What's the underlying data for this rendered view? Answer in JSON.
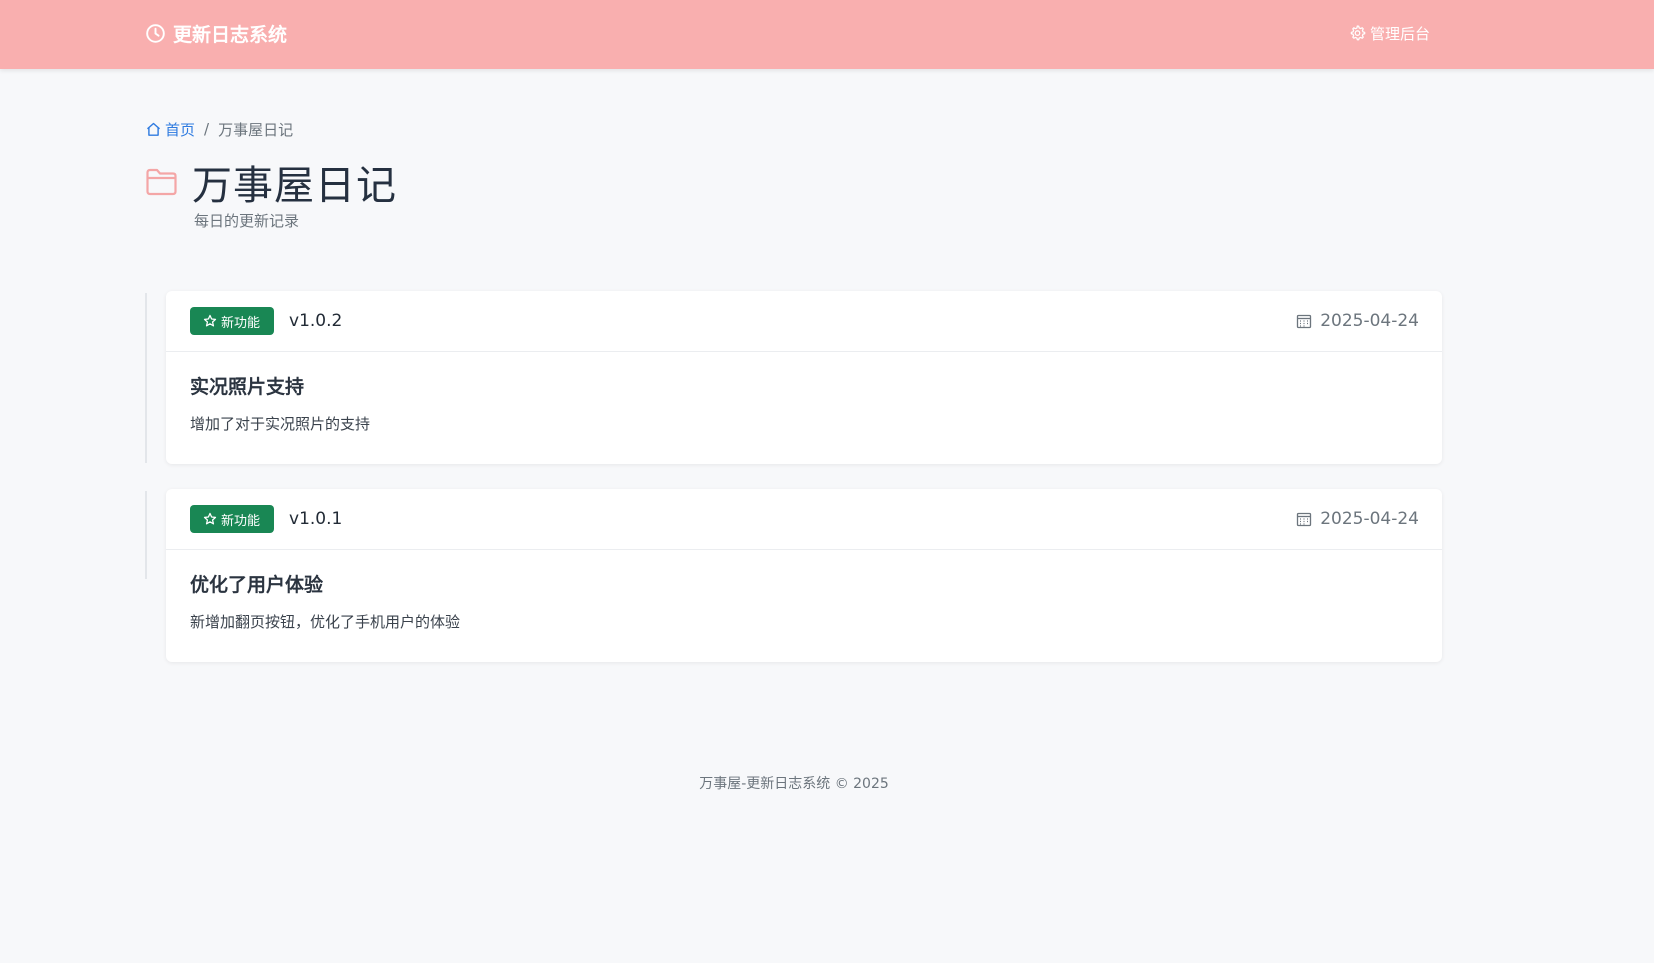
{
  "navbar": {
    "brand": "更新日志系统",
    "brand_icon": "clock-icon",
    "admin_label": "管理后台",
    "admin_icon": "gear-icon",
    "background": "#f9afaf"
  },
  "breadcrumb": {
    "home_label": "首页",
    "separator": "/",
    "current": "万事屋日记"
  },
  "header": {
    "title": "万事屋日记",
    "subtitle": "每日的更新记录",
    "icon": "folder-icon"
  },
  "entries": [
    {
      "badge": "新功能",
      "badge_color": "#198754",
      "version": "v1.0.2",
      "date": "2025-04-24",
      "title": "实况照片支持",
      "description": "增加了对于实况照片的支持"
    },
    {
      "badge": "新功能",
      "badge_color": "#198754",
      "version": "v1.0.1",
      "date": "2025-04-24",
      "title": "优化了用户体验",
      "description": "新增加翻页按钮，优化了手机用户的体验"
    }
  ],
  "footer": {
    "text": "万事屋-更新日志系统 © 2025"
  }
}
